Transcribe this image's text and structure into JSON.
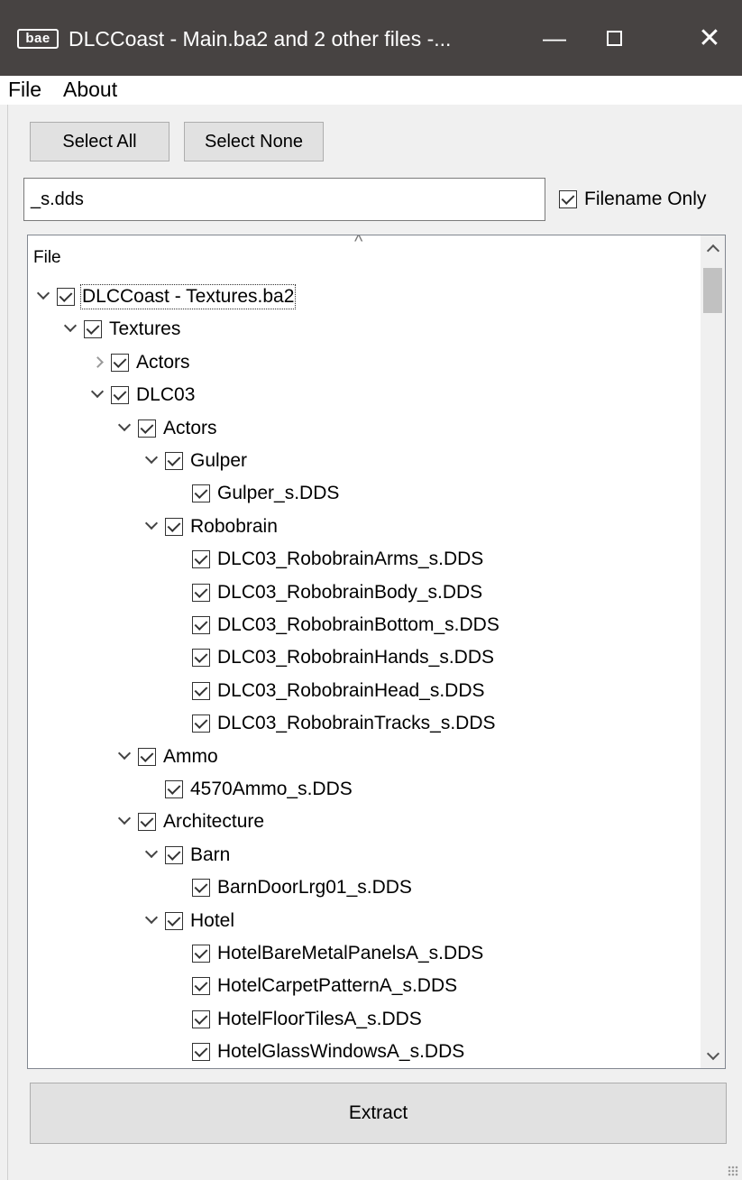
{
  "window": {
    "app_icon_text": "bae",
    "title": "DLCCoast - Main.ba2 and 2 other files -...",
    "minimize": "—",
    "close": "✕"
  },
  "menu": {
    "file": "File",
    "about": "About"
  },
  "toolbar": {
    "select_all": "Select All",
    "select_none": "Select None"
  },
  "filter": {
    "value": "_s.dds",
    "filename_only_label": "Filename Only",
    "filename_only_checked": true
  },
  "tree": {
    "header": "File",
    "rows": [
      {
        "label": "DLCCoast - Textures.ba2",
        "depth": 0,
        "expander": "open"
      },
      {
        "label": "Textures",
        "depth": 1,
        "expander": "open"
      },
      {
        "label": "Actors",
        "depth": 2,
        "expander": "closed"
      },
      {
        "label": "DLC03",
        "depth": 2,
        "expander": "open"
      },
      {
        "label": "Actors",
        "depth": 3,
        "expander": "open"
      },
      {
        "label": "Gulper",
        "depth": 4,
        "expander": "open"
      },
      {
        "label": "Gulper_s.DDS",
        "depth": 5,
        "expander": "none"
      },
      {
        "label": "Robobrain",
        "depth": 4,
        "expander": "open"
      },
      {
        "label": "DLC03_RobobrainArms_s.DDS",
        "depth": 5,
        "expander": "none"
      },
      {
        "label": "DLC03_RobobrainBody_s.DDS",
        "depth": 5,
        "expander": "none"
      },
      {
        "label": "DLC03_RobobrainBottom_s.DDS",
        "depth": 5,
        "expander": "none"
      },
      {
        "label": "DLC03_RobobrainHands_s.DDS",
        "depth": 5,
        "expander": "none"
      },
      {
        "label": "DLC03_RobobrainHead_s.DDS",
        "depth": 5,
        "expander": "none"
      },
      {
        "label": "DLC03_RobobrainTracks_s.DDS",
        "depth": 5,
        "expander": "none"
      },
      {
        "label": "Ammo",
        "depth": 3,
        "expander": "open"
      },
      {
        "label": "4570Ammo_s.DDS",
        "depth": 4,
        "expander": "none"
      },
      {
        "label": "Architecture",
        "depth": 3,
        "expander": "open"
      },
      {
        "label": "Barn",
        "depth": 4,
        "expander": "open"
      },
      {
        "label": "BarnDoorLrg01_s.DDS",
        "depth": 5,
        "expander": "none"
      },
      {
        "label": "Hotel",
        "depth": 4,
        "expander": "open"
      },
      {
        "label": "HotelBareMetalPanelsA_s.DDS",
        "depth": 5,
        "expander": "none"
      },
      {
        "label": "HotelCarpetPatternA_s.DDS",
        "depth": 5,
        "expander": "none"
      },
      {
        "label": "HotelFloorTilesA_s.DDS",
        "depth": 5,
        "expander": "none"
      },
      {
        "label": "HotelGlassWindowsA_s.DDS",
        "depth": 5,
        "expander": "none"
      }
    ]
  },
  "extract_label": "Extract"
}
